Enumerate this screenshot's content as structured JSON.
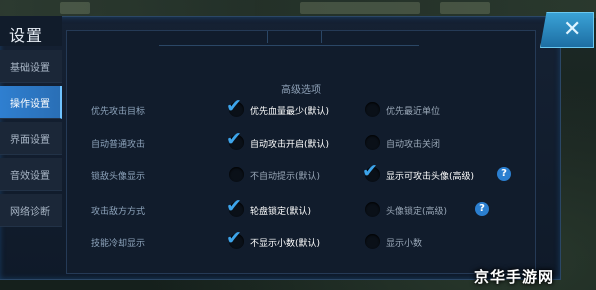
{
  "window": {
    "title": "设置",
    "close_icon": "close-x-icon"
  },
  "sidebar": {
    "items": [
      {
        "label": "基础设置",
        "active": false
      },
      {
        "label": "操作设置",
        "active": true
      },
      {
        "label": "界面设置",
        "active": false
      },
      {
        "label": "音效设置",
        "active": false
      },
      {
        "label": "网络诊断",
        "active": false
      }
    ]
  },
  "main": {
    "section_title": "高级选项",
    "rows": [
      {
        "label": "优先攻击目标",
        "options": [
          {
            "label": "优先血量最少(默认)",
            "checked": true
          },
          {
            "label": "优先最近单位",
            "checked": false
          }
        ]
      },
      {
        "label": "自动普通攻击",
        "options": [
          {
            "label": "自动攻击开启(默认)",
            "checked": true
          },
          {
            "label": "自动攻击关闭",
            "checked": false
          }
        ]
      },
      {
        "label": "锁敌头像显示",
        "options": [
          {
            "label": "不自动提示(默认)",
            "checked": false
          },
          {
            "label": "显示可攻击头像(高级)",
            "checked": true,
            "help": true
          }
        ]
      },
      {
        "label": "攻击敌方方式",
        "options": [
          {
            "label": "轮盘锁定(默认)",
            "checked": true
          },
          {
            "label": "头像锁定(高级)",
            "checked": false,
            "help": true
          }
        ]
      },
      {
        "label": "技能冷却显示",
        "options": [
          {
            "label": "不显示小数(默认)",
            "checked": true
          },
          {
            "label": "显示小数",
            "checked": false
          }
        ]
      }
    ],
    "help_glyph": "?"
  },
  "watermark": "京华手游网",
  "colors": {
    "accent": "#2f7fd0",
    "check": "#3da4ea",
    "panel": "#111c2c"
  }
}
